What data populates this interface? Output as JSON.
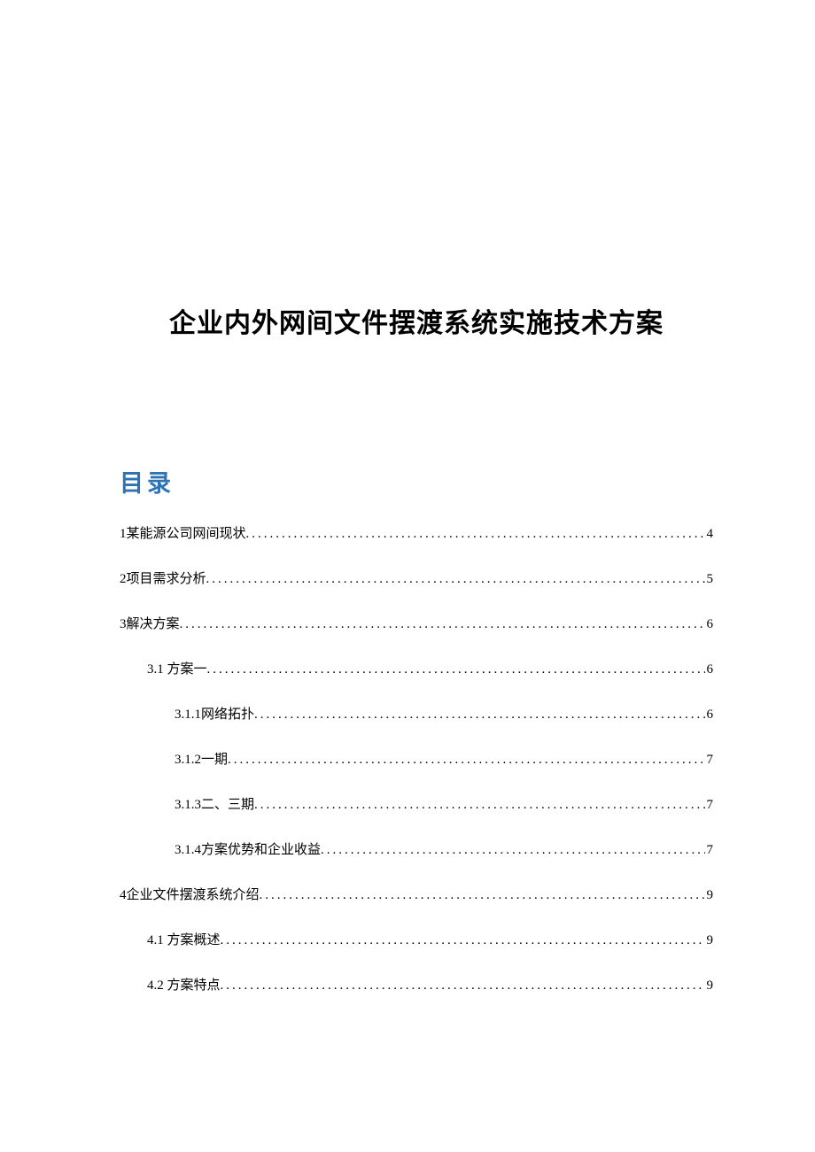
{
  "document": {
    "title": "企业内外网间文件摆渡系统实施技术方案"
  },
  "toc": {
    "heading": "目录",
    "items": [
      {
        "level": 1,
        "label": "1某能源公司网间现状",
        "page": "4"
      },
      {
        "level": 1,
        "label": "2项目需求分析",
        "page": "5"
      },
      {
        "level": 1,
        "label": "3解决方案",
        "page": "6"
      },
      {
        "level": 2,
        "label": "3.1 方案一",
        "page": "6"
      },
      {
        "level": 3,
        "label": "3.1.1网络拓扑",
        "page": "6"
      },
      {
        "level": 3,
        "label": "3.1.2一期",
        "page": "7"
      },
      {
        "level": 3,
        "label": "3.1.3二、三期",
        "page": "7"
      },
      {
        "level": 3,
        "label": "3.1.4方案优势和企业收益",
        "page": "7"
      },
      {
        "level": 1,
        "label": "4企业文件摆渡系统介绍",
        "page": "9"
      },
      {
        "level": 2,
        "label": "4.1 方案概述",
        "page": "9"
      },
      {
        "level": 2,
        "label": "4.2 方案特点",
        "page": "9"
      }
    ]
  }
}
